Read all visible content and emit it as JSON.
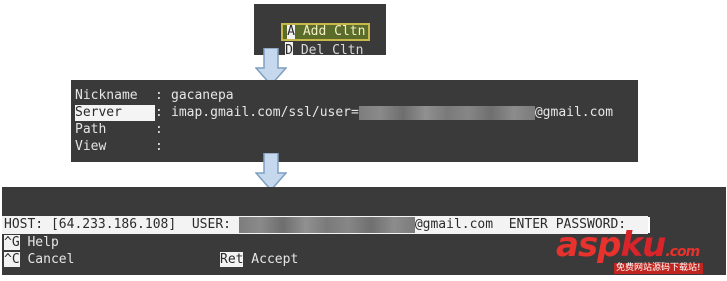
{
  "menu": {
    "selected_item": {
      "hotkey": "A",
      "label": " Add Cltn"
    },
    "next_item": {
      "hotkey": "D",
      "label": " Del Cltn"
    }
  },
  "config": {
    "fields": [
      {
        "label": "Nickname",
        "sep": ": ",
        "value": "gacanepa",
        "active": false
      },
      {
        "label": "Server",
        "sep": ": ",
        "value_prefix": "imap.gmail.com/ssl/user=",
        "value_suffix": "@gmail.com",
        "active": true
      },
      {
        "label": "Path",
        "sep": ": ",
        "value": "",
        "active": false
      },
      {
        "label": "View",
        "sep": ": ",
        "value": "",
        "active": false
      }
    ]
  },
  "prompt": {
    "host_text": "HOST: [64.233.186.108]  USER: ",
    "user_suffix": "@gmail.com  ENTER PASSWORD: ",
    "help": [
      {
        "key": "^G",
        "label": " Help"
      },
      {
        "key": "^C",
        "label": " Cancel",
        "key2": "Ret",
        "label2": " Accept"
      }
    ]
  },
  "watermark": {
    "brand_a": "asp",
    "brand_b": "ku",
    "tld": ".com",
    "tagline": "免费网站源码下载站!"
  },
  "colors": {
    "terminal_bg": "#3a3a3a",
    "highlight_bg": "#f3f3f3",
    "menu_selected_bg": "#5b6b2a",
    "menu_selected_border": "#c9b84a",
    "arrow_fill": "#c5d8ee",
    "arrow_stroke": "#7f9fbf",
    "watermark_red": "#e7322d"
  },
  "icons": {
    "arrow": "down-arrow-icon"
  }
}
